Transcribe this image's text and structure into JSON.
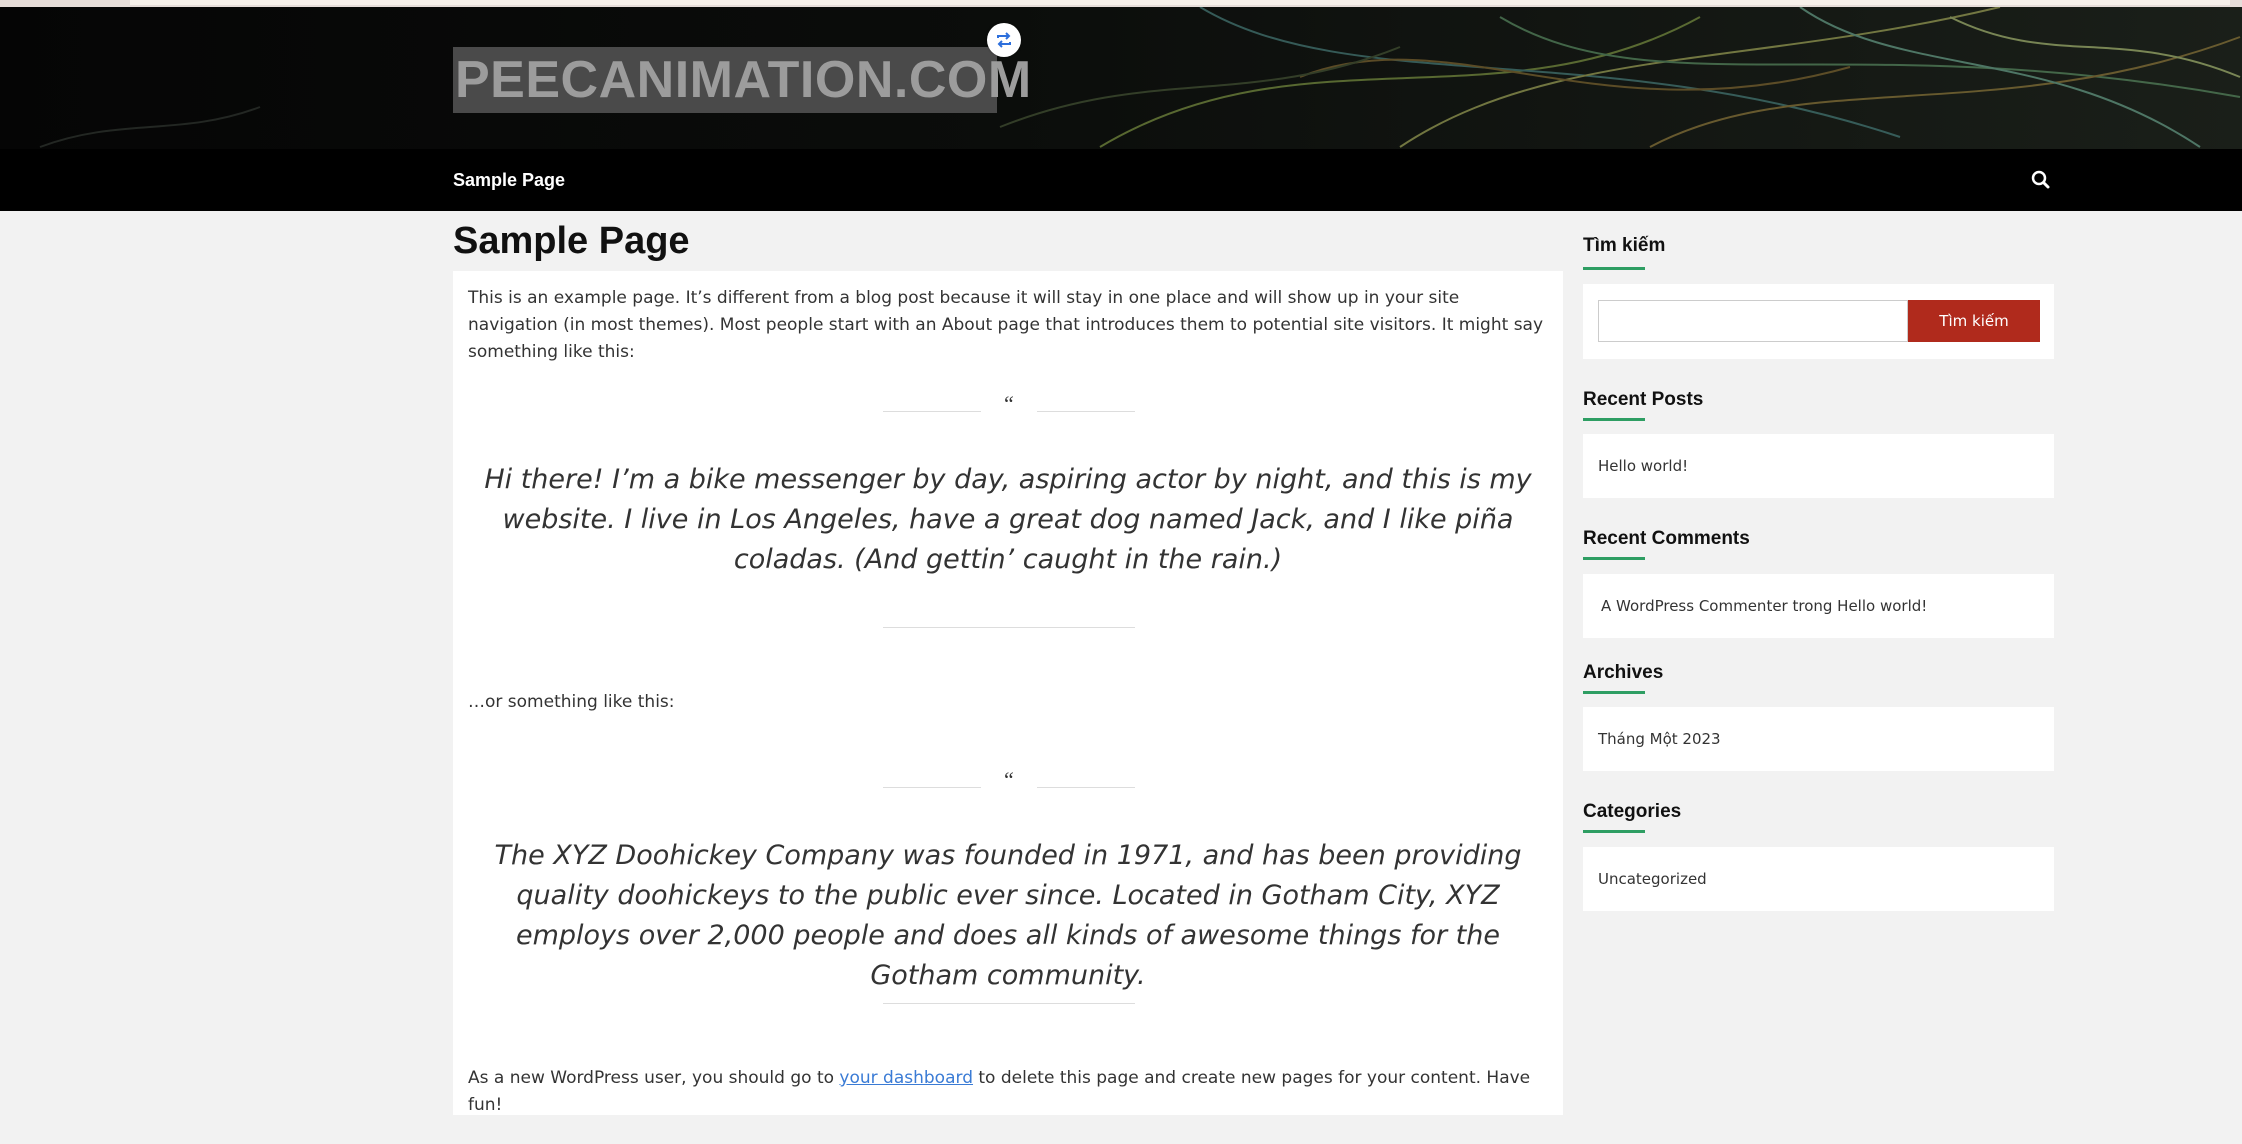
{
  "site": {
    "title": "PEECANIMATION.COM"
  },
  "nav": {
    "items": [
      "Sample Page"
    ]
  },
  "page": {
    "title": "Sample Page",
    "intro": "This is an example page. It’s different from a blog post because it will stay in one place and will show up in your site navigation (in most themes). Most people start with an About page that introduces them to potential site visitors. It might say something like this:",
    "quote_mark": "“",
    "quote1": "Hi there! I’m a bike messenger by day, aspiring actor by night, and this is my website. I live in Los Angeles, have a great dog named Jack, and I like piña coladas. (And gettin’ caught in the rain.)",
    "middle": "…or something like this:",
    "quote2": "The XYZ Doohickey Company was founded in 1971, and has been providing quality doohickeys to the public ever since. Located in Gotham City, XYZ employs over 2,000 people and does all kinds of awesome things for the Gotham community.",
    "outro_before": "As a new WordPress user, you should go to ",
    "outro_link": "your dashboard",
    "outro_after": " to delete this page and create new pages for your content. Have fun!"
  },
  "sidebar": {
    "search": {
      "title": "Tìm kiếm",
      "button": "Tìm kiếm",
      "value": ""
    },
    "recent_posts": {
      "title": "Recent Posts",
      "items": [
        "Hello world!"
      ]
    },
    "recent_comments": {
      "title": "Recent Comments",
      "items": [
        "A WordPress Commenter trong Hello world!"
      ]
    },
    "archives": {
      "title": "Archives",
      "items": [
        "Tháng Một 2023"
      ]
    },
    "categories": {
      "title": "Categories",
      "items": [
        "Uncategorized"
      ]
    }
  },
  "colors": {
    "accent_underline": "#2e9e63",
    "search_button": "#b02a1c",
    "link": "#3a7bd5"
  }
}
